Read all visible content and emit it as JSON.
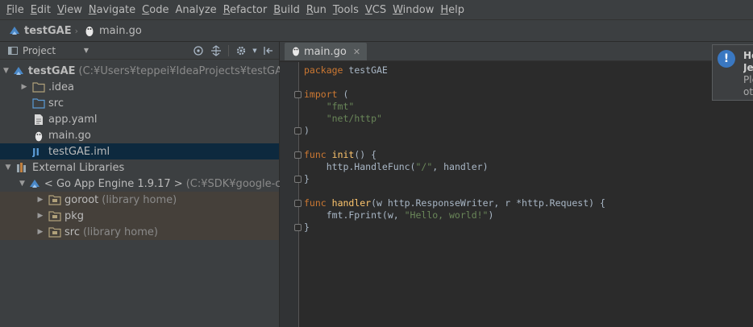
{
  "menu": [
    {
      "key": "F",
      "rest": "ile"
    },
    {
      "key": "E",
      "rest": "dit"
    },
    {
      "key": "V",
      "rest": "iew"
    },
    {
      "key": "N",
      "rest": "avigate"
    },
    {
      "key": "C",
      "rest": "ode"
    },
    {
      "key": "",
      "rest": "Analyze"
    },
    {
      "key": "R",
      "rest": "efactor"
    },
    {
      "key": "B",
      "rest": "uild"
    },
    {
      "key": "R",
      "rest": "un"
    },
    {
      "key": "T",
      "rest": "ools"
    },
    {
      "key": "V",
      "rest": "CS"
    },
    {
      "key": "W",
      "rest": "indow"
    },
    {
      "key": "H",
      "rest": "elp"
    }
  ],
  "breadcrumb": {
    "project": "testGAE",
    "file": "main.go"
  },
  "project_panel": {
    "view_label": "Project",
    "tree": [
      {
        "label": "testGAE",
        "hint": "(C:¥Users¥teppei¥IdeaProjects¥testGAE)",
        "indent": 0,
        "arrow": "down",
        "icon": "gae-project-icon",
        "bold": true
      },
      {
        "label": ".idea",
        "hint": "",
        "indent": 1,
        "arrow": "right",
        "icon": "folder-icon"
      },
      {
        "label": "src",
        "hint": "",
        "indent": 1,
        "arrow": "",
        "icon": "source-folder-icon"
      },
      {
        "label": "app.yaml",
        "hint": "",
        "indent": 1,
        "arrow": "",
        "icon": "yaml-file-icon"
      },
      {
        "label": "main.go",
        "hint": "",
        "indent": 1,
        "arrow": "",
        "icon": "go-file-icon"
      },
      {
        "label": "testGAE.iml",
        "hint": "",
        "indent": 1,
        "arrow": "",
        "icon": "iml-file-icon",
        "selected": true
      },
      {
        "label": "External Libraries",
        "hint": "",
        "indent": 0,
        "arrow": "down",
        "icon": "libraries-icon"
      },
      {
        "label": "< Go App Engine 1.9.17 >",
        "hint": "(C:¥SDK¥google-cloud",
        "indent": 1,
        "arrow": "down",
        "icon": "gae-sdk-icon"
      },
      {
        "label": "goroot",
        "hint": "(library home)",
        "indent": 2,
        "arrow": "right",
        "icon": "library-folder-icon",
        "lib": true
      },
      {
        "label": "pkg",
        "hint": "",
        "indent": 2,
        "arrow": "right",
        "icon": "library-folder-icon",
        "lib": true
      },
      {
        "label": "src",
        "hint": "(library home)",
        "indent": 2,
        "arrow": "right",
        "icon": "library-folder-icon",
        "lib": true
      }
    ]
  },
  "editor": {
    "tab_label": "main.go",
    "code": [
      [
        [
          "kw",
          "package"
        ],
        [
          "plain",
          " testGAE"
        ]
      ],
      [],
      [
        [
          "kw",
          "import"
        ],
        [
          "plain",
          " ("
        ]
      ],
      [
        [
          "plain",
          "    "
        ],
        [
          "str",
          "\"fmt\""
        ]
      ],
      [
        [
          "plain",
          "    "
        ],
        [
          "str",
          "\"net/http\""
        ]
      ],
      [
        [
          "plain",
          ")"
        ]
      ],
      [],
      [
        [
          "kw",
          "func"
        ],
        [
          "plain",
          " "
        ],
        [
          "fn",
          "init"
        ],
        [
          "plain",
          "() {"
        ]
      ],
      [
        [
          "plain",
          "    http.HandleFunc("
        ],
        [
          "str",
          "\"/\""
        ],
        [
          "plain",
          ", handler)"
        ]
      ],
      [
        [
          "plain",
          "}"
        ]
      ],
      [],
      [
        [
          "kw",
          "func"
        ],
        [
          "plain",
          " "
        ],
        [
          "fn",
          "handler"
        ],
        [
          "plain",
          "(w http.ResponseWriter, r *http.Request) {"
        ]
      ],
      [
        [
          "plain",
          "    fmt.Fprint(w, "
        ],
        [
          "str",
          "\"Hello, world!\""
        ],
        [
          "plain",
          ")"
        ]
      ],
      [
        [
          "plain",
          "}"
        ]
      ]
    ]
  },
  "notification": {
    "title": "He",
    "title2": "Je",
    "body1": "Ple",
    "body2": "oth"
  }
}
